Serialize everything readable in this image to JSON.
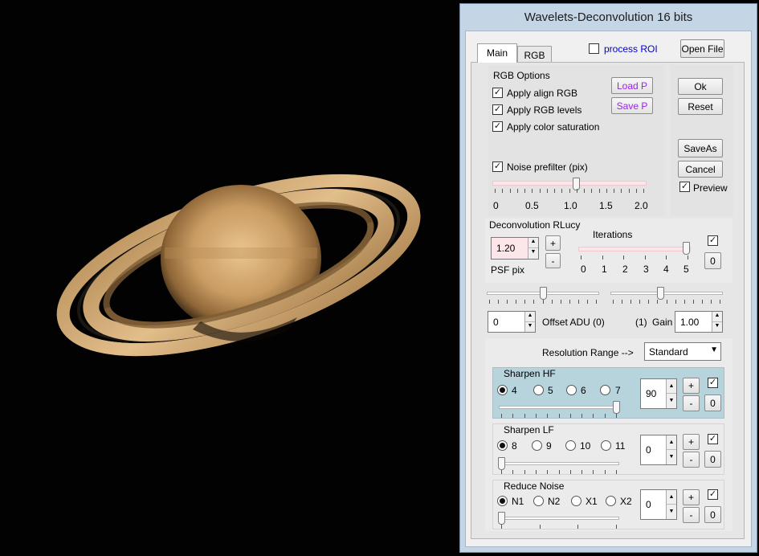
{
  "window": {
    "title": "Wavelets-Deconvolution 16 bits"
  },
  "tabs": [
    {
      "label": "Main"
    },
    {
      "label": "RGB"
    }
  ],
  "header": {
    "process_roi_label": "process ROI",
    "process_roi_checked": false,
    "open_file_label": "Open File"
  },
  "rgb_options": {
    "title": "RGB Options",
    "load_label": "Load P",
    "save_label": "Save P",
    "checks": [
      {
        "label": "Apply align RGB",
        "checked": true
      },
      {
        "label": "Apply RGB levels",
        "checked": true
      },
      {
        "label": "Apply color saturation",
        "checked": true
      }
    ],
    "noise_prefilter_label": "Noise prefilter (pix)",
    "noise_prefilter_checked": true,
    "noise_prefilter_value": 1.0,
    "scale_labels": [
      "0",
      "0.5",
      "1.0",
      "1.5",
      "2.0"
    ]
  },
  "actions": {
    "ok": "Ok",
    "reset": "Reset",
    "saveas": "SaveAs",
    "cancel": "Cancel",
    "preview": "Preview",
    "preview_checked": true
  },
  "deconvolution": {
    "title": "Deconvolution RLucy",
    "psf_value": "1.20",
    "psf_label": "PSF pix",
    "plus": "+",
    "minus": "-",
    "iterations_label": "Iterations",
    "iterations_value": 5,
    "iteration_labels": [
      "0",
      "1",
      "2",
      "3",
      "4",
      "5"
    ],
    "enabled_checked": true,
    "zero_btn": "0"
  },
  "offset": {
    "value": "0",
    "label": "Offset ADU (0)"
  },
  "gain": {
    "prefix": "(1)",
    "label": "Gain",
    "value": "1.00"
  },
  "resolution": {
    "label": "Resolution Range  -->",
    "selected": "Standard"
  },
  "sharpen_hf": {
    "title": "Sharpen HF",
    "options": [
      "4",
      "5",
      "6",
      "7"
    ],
    "selected_index": 0,
    "value": "90",
    "checked": true,
    "plus": "+",
    "minus": "-",
    "zero": "0"
  },
  "sharpen_lf": {
    "title": "Sharpen LF",
    "options": [
      "8",
      "9",
      "10",
      "11"
    ],
    "selected_index": 0,
    "value": "0",
    "checked": true,
    "plus": "+",
    "minus": "-",
    "zero": "0"
  },
  "reduce_noise": {
    "title": "Reduce Noise",
    "options": [
      "N1",
      "N2",
      "X1",
      "X2"
    ],
    "selected_index": 0,
    "value": "0",
    "checked": true,
    "plus": "+",
    "minus": "-",
    "zero": "0"
  },
  "colors": {
    "hf_panel": "#b7d3db",
    "accent_purple": "#a020f0",
    "link_blue": "#0000cc",
    "dialog_frame": "#c4d5e6"
  },
  "image": {
    "subject": "saturn-planet-image"
  }
}
